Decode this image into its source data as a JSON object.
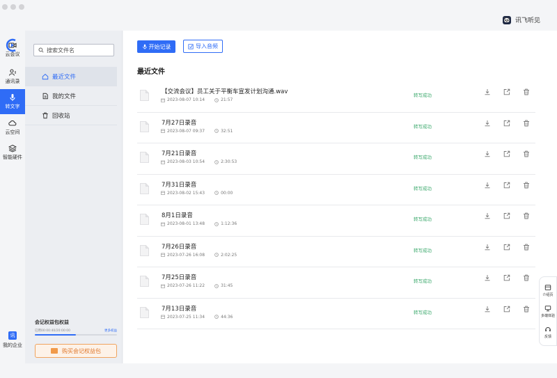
{
  "app": {
    "brand_name": "讯飞听见",
    "logo_char": "讯"
  },
  "rail": {
    "items": [
      {
        "label": "云会议",
        "icon": "camera-icon"
      },
      {
        "label": "通讯录",
        "icon": "contacts-icon"
      },
      {
        "label": "转文字",
        "icon": "mic-icon",
        "active": true
      },
      {
        "label": "云空间",
        "icon": "cloud-icon"
      },
      {
        "label": "智能硬件",
        "icon": "layers-icon"
      }
    ],
    "enterprise": {
      "badge": "讯",
      "label": "我的企业"
    }
  },
  "sidebar": {
    "search_placeholder": "搜索文件名",
    "nav": [
      {
        "label": "最近文件",
        "icon": "home-icon",
        "active": true
      },
      {
        "label": "我的文件",
        "icon": "file-icon"
      },
      {
        "label": "回收站",
        "icon": "trash-icon"
      }
    ],
    "quota": {
      "title": "会记权益包权益",
      "usage": "已用00:00:40/20:00:00",
      "more": "更多权益",
      "used_fraction": 0.5
    },
    "buy_label": "购买会记权益包"
  },
  "toolbar": {
    "start_label": "开始记录",
    "import_label": "导入音频"
  },
  "main": {
    "section_title": "最近文件",
    "files": [
      {
        "name": "【交流会议】员工关于平衡车宣发计划沟通.wav",
        "date": "2023-08-07 10:14",
        "duration": "21:57",
        "status": "转写成功"
      },
      {
        "name": "7月27日录音",
        "date": "2023-08-07 09:37",
        "duration": "32:51",
        "status": "转写成功"
      },
      {
        "name": "7月21日录音",
        "date": "2023-08-03 10:54",
        "duration": "2:30:53",
        "status": "转写成功"
      },
      {
        "name": "7月31日录音",
        "date": "2023-08-02 15:43",
        "duration": "00:00",
        "status": "转写成功"
      },
      {
        "name": "8月1日录音",
        "date": "2023-08-01 13:48",
        "duration": "1:12:36",
        "status": "转写成功"
      },
      {
        "name": "7月26日录音",
        "date": "2023-07-26 16:08",
        "duration": "2:02:25",
        "status": "转写成功"
      },
      {
        "name": "7月25日录音",
        "date": "2023-07-26 11:22",
        "duration": "31:45",
        "status": "转写成功"
      },
      {
        "name": "7月13日录音",
        "date": "2023-07-25 11:34",
        "duration": "44:36",
        "status": "转写成功"
      }
    ]
  },
  "float_panel": {
    "items": [
      {
        "label": "介绍页",
        "icon": "intro-icon"
      },
      {
        "label": "多端体验",
        "icon": "monitor-icon"
      },
      {
        "label": "反馈",
        "icon": "headset-icon"
      }
    ]
  },
  "colors": {
    "accent": "#2f6cf6",
    "success": "#3aa86b",
    "orange": "#e0782c"
  }
}
